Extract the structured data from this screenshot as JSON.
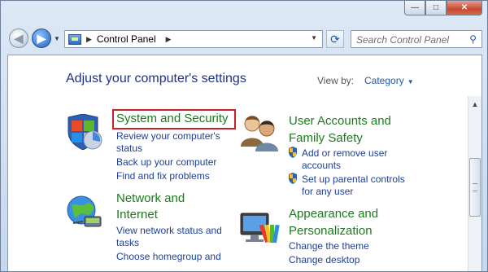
{
  "window": {
    "caption_buttons": {
      "minimize": "—",
      "maximize": "□",
      "close": "✕"
    }
  },
  "toolbar": {
    "back_glyph": "◀",
    "forward_glyph": "▶",
    "address": {
      "crumbs": [
        "Control Panel"
      ],
      "separator_glyph": "▶",
      "drop_glyph": "▼"
    },
    "refresh_glyph": "⟳",
    "search": {
      "placeholder": "Search Control Panel",
      "icon": "magnifier-icon",
      "glyph": "⚲"
    }
  },
  "main": {
    "heading": "Adjust your computer's settings",
    "view_by": {
      "label": "View by:",
      "value": "Category",
      "arrow": "▼"
    },
    "categories": [
      {
        "title": "System and Security",
        "links": [
          "Review your computer's",
          "status",
          "Back up your computer",
          "Find and fix problems"
        ]
      },
      {
        "title_lines": [
          "Network and",
          "Internet"
        ],
        "links": [
          "View network status and",
          "tasks",
          "Choose homegroup and"
        ]
      },
      {
        "title_lines": [
          "User Accounts and",
          "Family Safety"
        ],
        "links": [
          "Add or remove user",
          "accounts",
          "Set up parental controls",
          "for any user"
        ]
      },
      {
        "title_lines": [
          "Appearance and",
          "Personalization"
        ],
        "links": [
          "Change the theme",
          "Change desktop"
        ]
      }
    ]
  },
  "scrollbar": {
    "up_glyph": "▲"
  }
}
